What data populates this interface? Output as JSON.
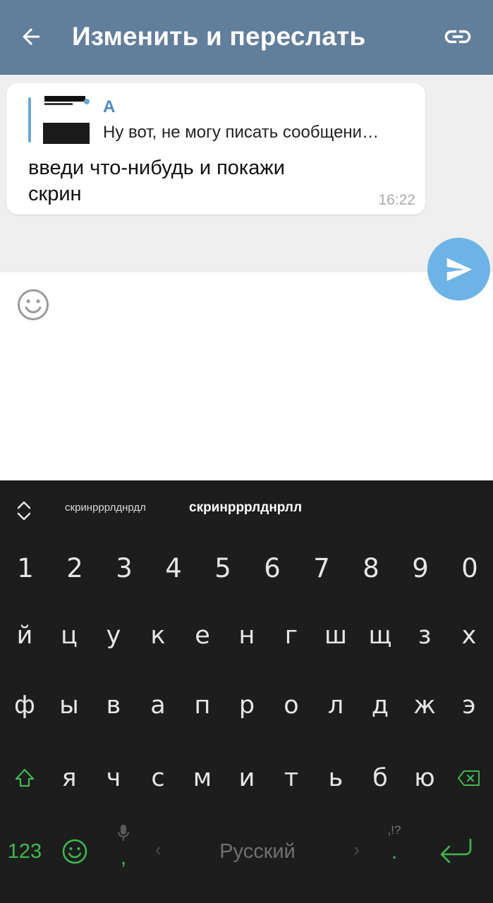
{
  "header": {
    "title": "Изменить и переслать",
    "back_icon": "arrow-left-icon",
    "link_icon": "link-icon",
    "background": "#617e9b"
  },
  "message": {
    "quote_name": "А",
    "quote_text": "Ну вот, не могу писать сообщени…",
    "text": "введи что-нибудь и покажи скрин",
    "time": "16:22"
  },
  "composer": {
    "emoji_icon": "smiley-icon",
    "input_value": "",
    "send_icon": "paper-plane-icon",
    "send_color": "#6eb3e6"
  },
  "keyboard": {
    "suggestions": [
      "скринрррлднрдл",
      "скринрррлднрлл"
    ],
    "numbers": [
      "1",
      "2",
      "3",
      "4",
      "5",
      "6",
      "7",
      "8",
      "9",
      "0"
    ],
    "row1": [
      "й",
      "ц",
      "у",
      "к",
      "е",
      "н",
      "г",
      "ш",
      "щ",
      "з",
      "х"
    ],
    "row2": [
      "ф",
      "ы",
      "в",
      "а",
      "п",
      "р",
      "о",
      "л",
      "д",
      "ж",
      "э"
    ],
    "row3": [
      "я",
      "ч",
      "с",
      "м",
      "и",
      "т",
      "ь",
      "б",
      "ю"
    ],
    "mode_key": "123",
    "comma_key": ",",
    "space_label": "Русский",
    "period_key": ".",
    "punct_hint": ",!?",
    "accent_color": "#3fb94f"
  }
}
